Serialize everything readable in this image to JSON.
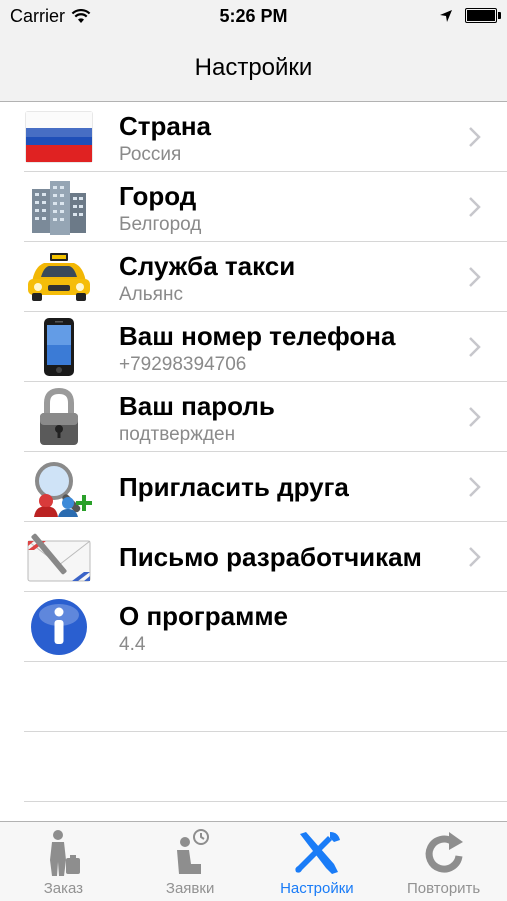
{
  "status_bar": {
    "carrier": "Carrier",
    "time": "5:26 PM",
    "battery_level": 1.0
  },
  "nav": {
    "title": "Настройки"
  },
  "rows": [
    {
      "title": "Страна",
      "subtitle": "Россия",
      "icon": "russia-flag-icon"
    },
    {
      "title": "Город",
      "subtitle": "Белгород",
      "icon": "buildings-icon"
    },
    {
      "title": "Служба такси",
      "subtitle": "Альянс",
      "icon": "taxi-icon"
    },
    {
      "title": "Ваш номер телефона",
      "subtitle": "+79298394706",
      "icon": "phone-icon"
    },
    {
      "title": "Ваш пароль",
      "subtitle": "подтвержден",
      "icon": "lock-icon"
    },
    {
      "title": "Пригласить друга",
      "icon": "invite-friend-icon"
    },
    {
      "title": "Письмо разработчикам",
      "icon": "mail-icon"
    },
    {
      "title": "О программе",
      "subtitle": "4.4",
      "icon": "info-icon"
    }
  ],
  "tabs": [
    {
      "label": "Заказ",
      "icon": "order-person-icon"
    },
    {
      "label": "Заявки",
      "icon": "requests-icon"
    },
    {
      "label": "Настройки",
      "icon": "settings-tools-icon",
      "active": true
    },
    {
      "label": "Повторить",
      "icon": "repeat-icon"
    }
  ],
  "colors": {
    "accent": "#1a7cf7",
    "tab_inactive": "#929292",
    "subtitle": "#8a8a8a"
  }
}
